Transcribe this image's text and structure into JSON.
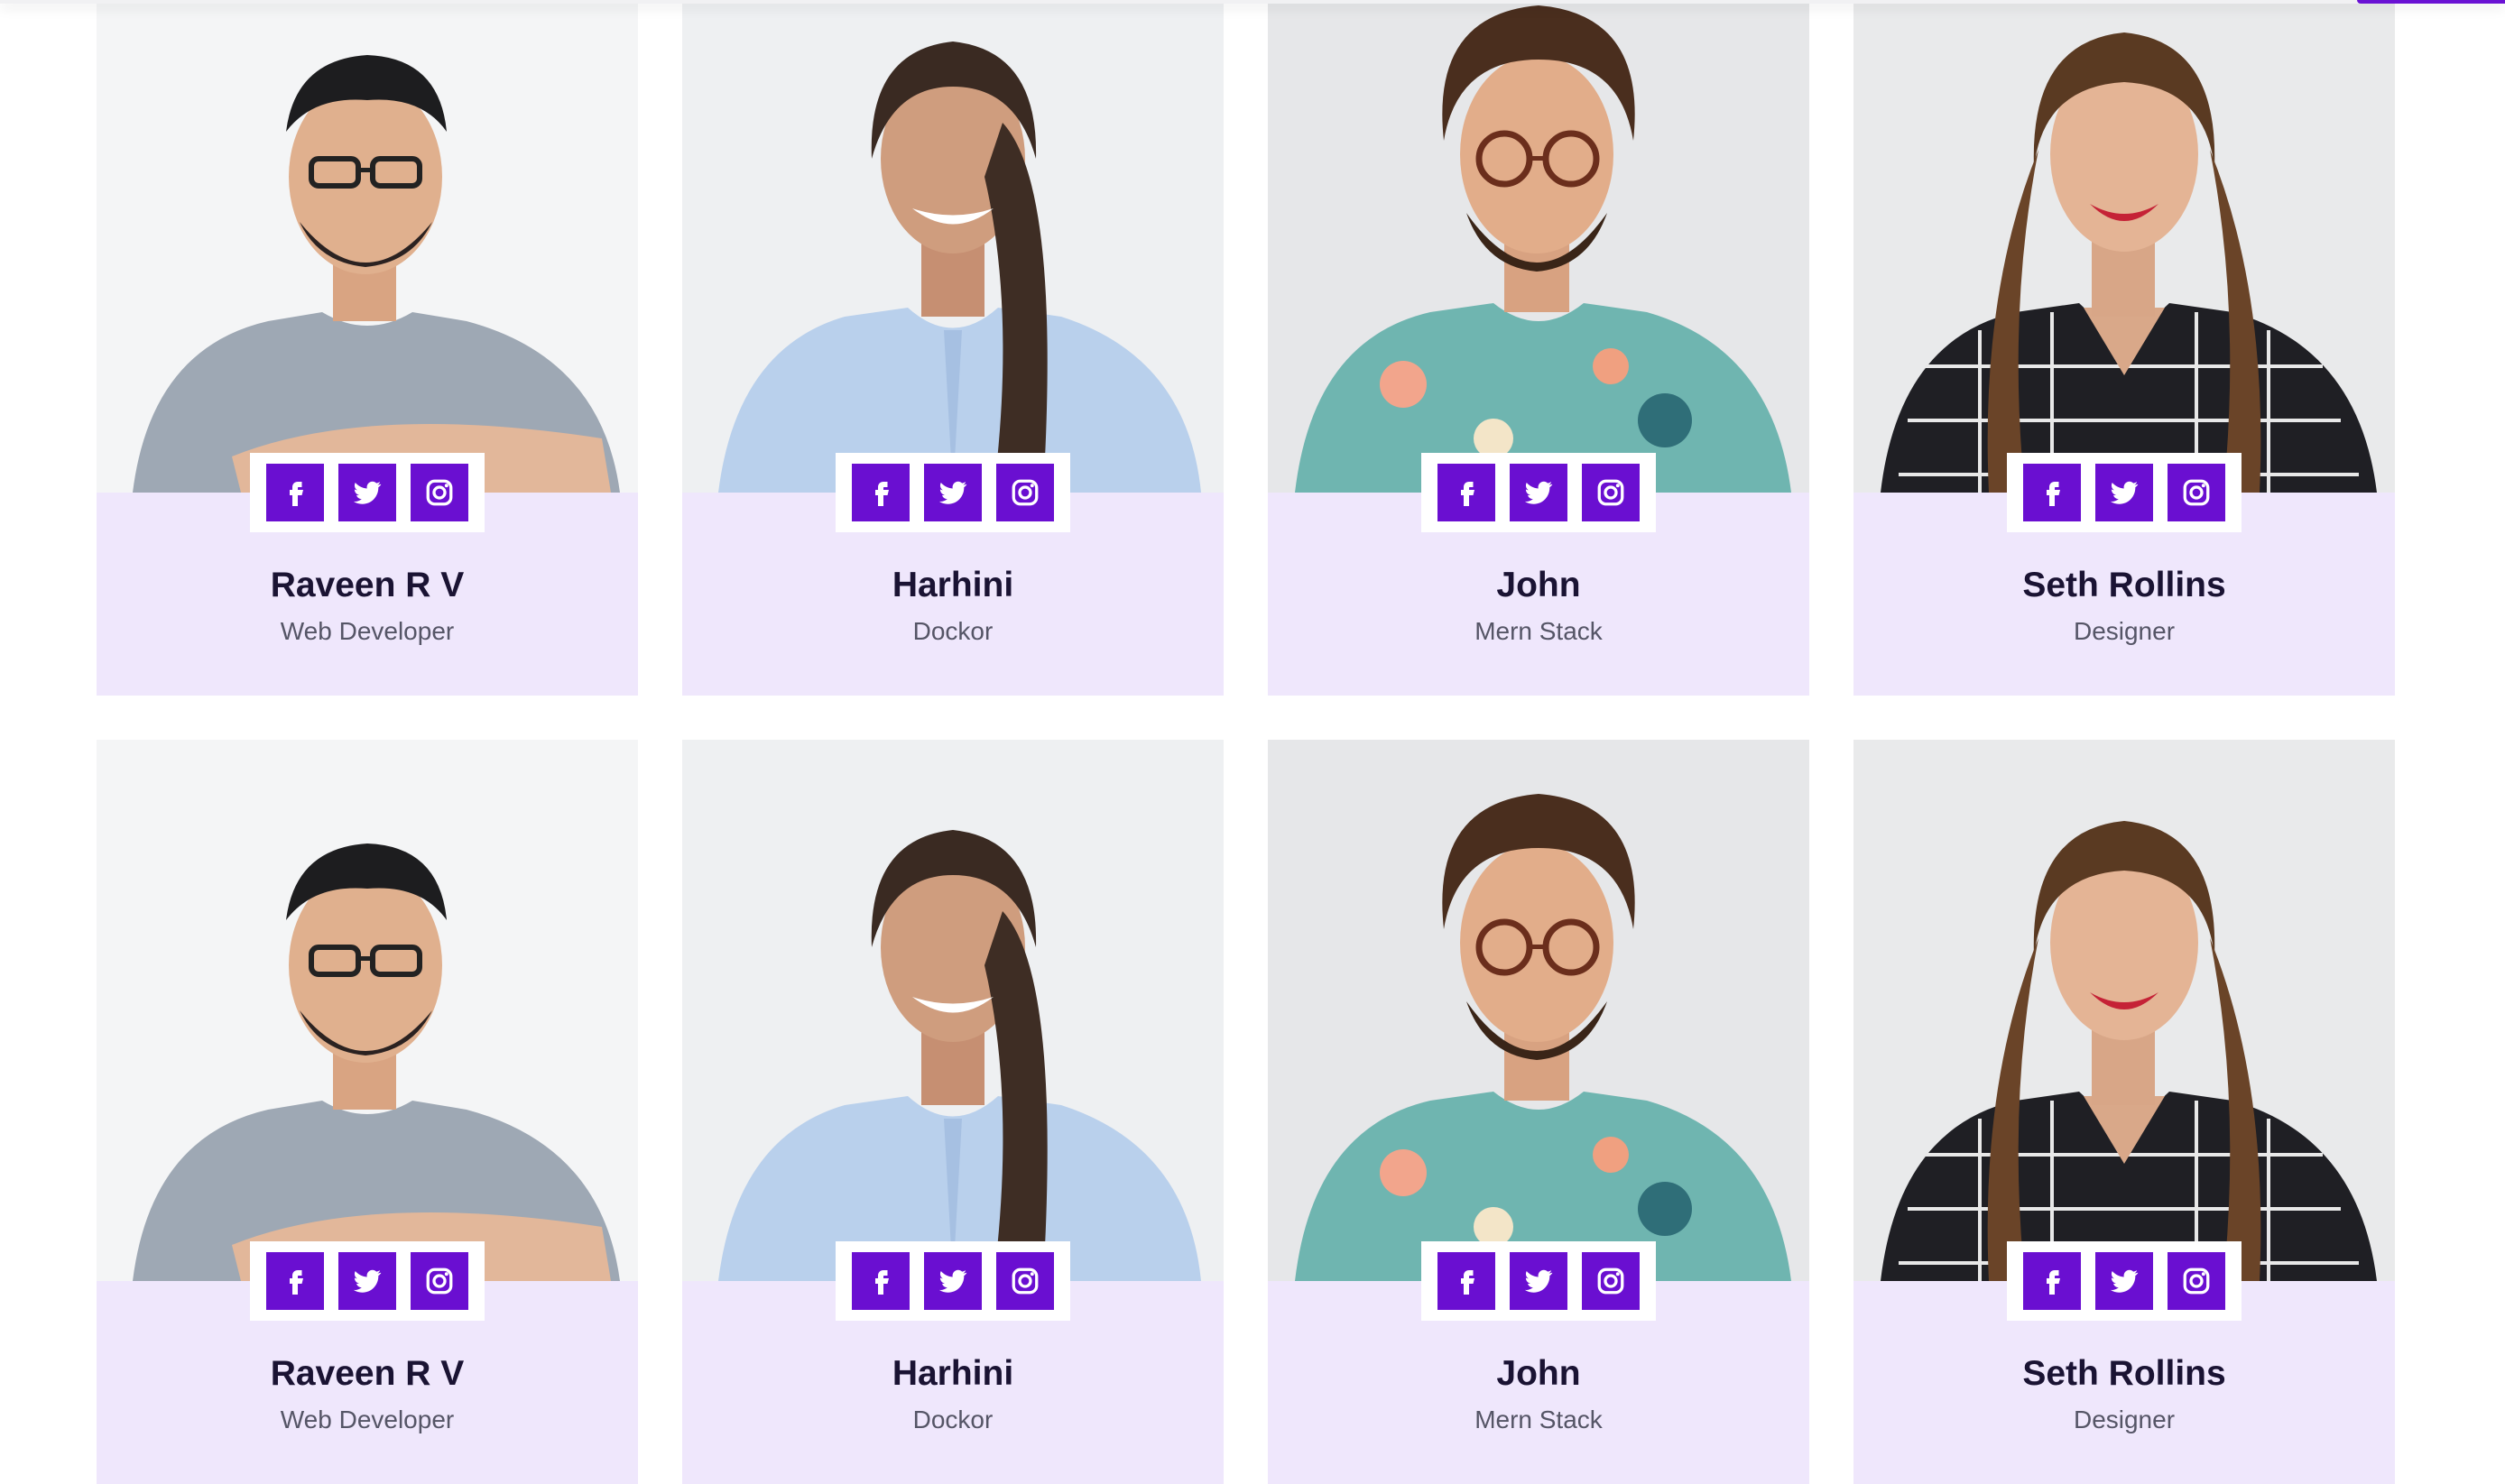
{
  "team": {
    "rows": [
      [
        {
          "name": "Raveen R V",
          "role": "Web Developer"
        },
        {
          "name": "Harhini",
          "role": "Dockor"
        },
        {
          "name": "John",
          "role": "Mern Stack"
        },
        {
          "name": "Seth Rollins",
          "role": "Designer"
        }
      ],
      [
        {
          "name": "Raveen R V",
          "role": "Web Developer"
        },
        {
          "name": "Harhini",
          "role": "Dockor"
        },
        {
          "name": "John",
          "role": "Mern Stack"
        },
        {
          "name": "Seth Rollins",
          "role": "Designer"
        }
      ]
    ]
  },
  "social_icons": [
    "facebook-icon",
    "twitter-icon",
    "instagram-icon"
  ],
  "colors": {
    "accent": "#6a0fd1",
    "card_info_bg": "#efe7fc",
    "name_text": "#1a1333",
    "role_text": "#555566"
  }
}
